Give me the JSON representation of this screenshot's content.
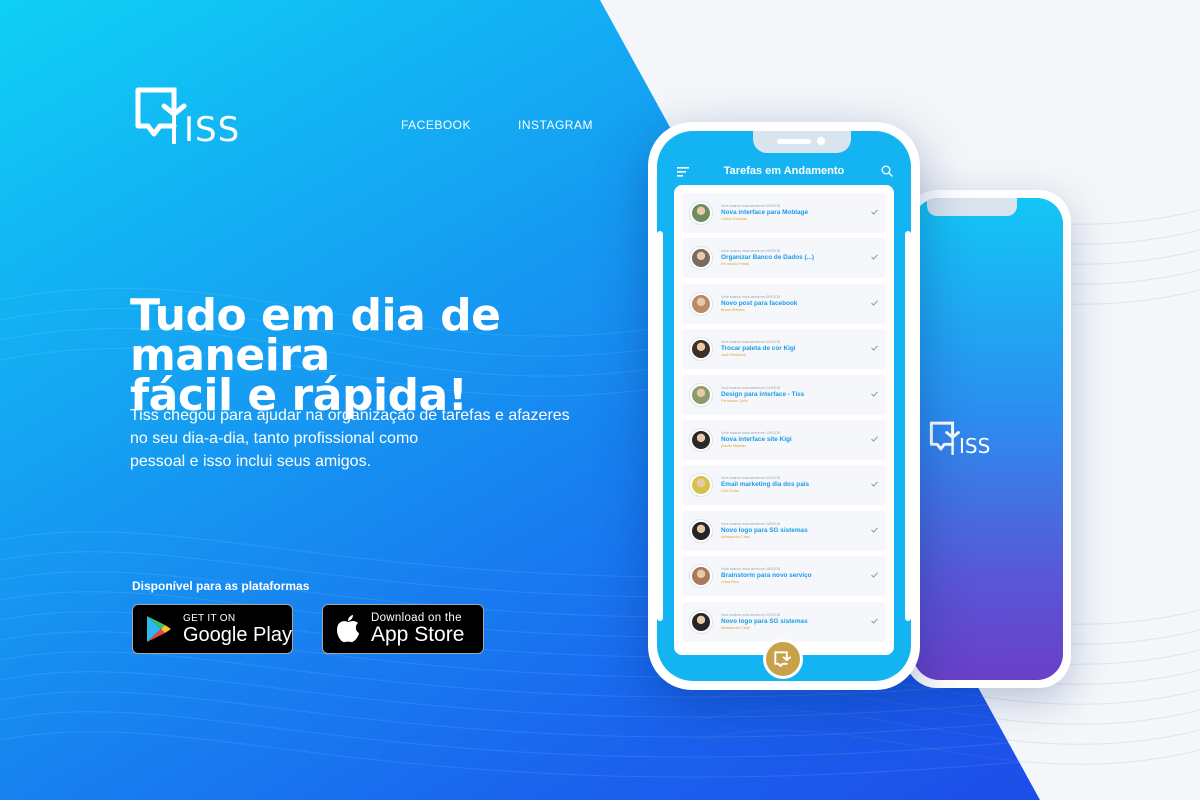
{
  "brand": {
    "logo_text": "ISS"
  },
  "nav": {
    "facebook": "FACEBOOK",
    "instagram": "INSTAGRAM"
  },
  "hero": {
    "line1": "Tudo em dia de maneira",
    "line2": "fácil e rápida!",
    "sub1": "Tiss chegou para ajudar na organização de tarefas e afazeres",
    "sub2": "no seu dia-a-dia, tanto profissional como",
    "sub3": "pessoal e isso inclui seus amigos."
  },
  "platforms": {
    "label": "Disponível para as plataformas",
    "google": {
      "small": "GET IT ON",
      "big": "Google Play"
    },
    "apple": {
      "small": "Download on the",
      "big": "App Store"
    }
  },
  "app": {
    "title": "Tarefas em Andamento",
    "tasks": [
      {
        "meta": "Você acabou essa tarefa em 09/03/18",
        "name": "Nova interface para Moblage",
        "person": "Carlos Eduardo",
        "color": "#6b8f5e"
      },
      {
        "meta": "Você acabou essa tarefa em 09/03/18",
        "name": "Organizar Banco de Dados (...)",
        "person": "Fernando Farias",
        "color": "#7a6a60"
      },
      {
        "meta": "Você acabou essa tarefa em 09/03/18",
        "name": "Novo post para facebook",
        "person": "Bruno Martins",
        "color": "#b88a6a"
      },
      {
        "meta": "Você acabou essa tarefa em 13/03/18",
        "name": "Trocar paleta de cor Kigi",
        "person": "José Medeiros",
        "color": "#3d3028"
      },
      {
        "meta": "Você acabou essa tarefa em 14/03/18",
        "name": "Design para interface - Tiss",
        "person": "Fernanda Curty",
        "color": "#8c9b6e"
      },
      {
        "meta": "Você acabou essa tarefa em 14/03/18",
        "name": "Nova interface site Kigi",
        "person": "Adolfo Mathias",
        "color": "#2a2a2a"
      },
      {
        "meta": "Você acabou essa tarefa em 14/03/18",
        "name": "Email marketing dia dos pais",
        "person": "Caio Dutra",
        "color": "#d6c24a"
      },
      {
        "meta": "Você acabou essa tarefa em 16/03/18",
        "name": "Novo logo para SG sistemas",
        "person": "Alessandro Clark",
        "color": "#262626"
      },
      {
        "meta": "Você acabou essa tarefa em 18/03/18",
        "name": "Brainstorm para novo serviço",
        "person": "Clara Rios",
        "color": "#a97a5e"
      },
      {
        "meta": "Você acabou essa tarefa em 19/03/18",
        "name": "Novo logo para SG sistemas",
        "person": "Alessandro Clark",
        "color": "#262626"
      }
    ]
  },
  "colors": {
    "accent_gold": "#c7a24a",
    "task_blue": "#1a9be8",
    "person_orange": "#e2a33a"
  },
  "icons": [
    "menu-icon",
    "search-icon",
    "check-icon",
    "fab-logo-icon",
    "google-play-icon",
    "apple-icon"
  ]
}
